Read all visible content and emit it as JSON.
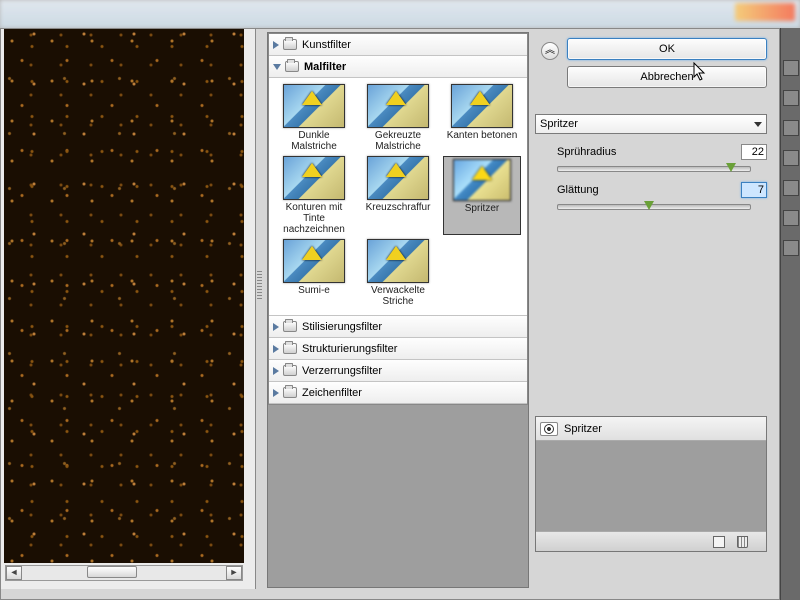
{
  "dialog": {
    "ok_label": "OK",
    "cancel_label": "Abbrechen"
  },
  "categories": {
    "kunstfilter": "Kunstfilter",
    "malfilter": "Malfilter",
    "stilisierung": "Stilisierungsfilter",
    "strukturierung": "Strukturierungsfilter",
    "verzerrung": "Verzerrungsfilter",
    "zeichen": "Zeichenfilter"
  },
  "malfilter_thumbs": [
    "Dunkle Malstriche",
    "Gekreuzte Malstriche",
    "Kanten betonen",
    "Konturen mit Tinte nachzeichnen",
    "Kreuzschraffur",
    "Spritzer",
    "Sumi-e",
    "Verwackelte Striche"
  ],
  "filter_dropdown": "Spritzer",
  "params": {
    "spray_radius_label": "Sprühradius",
    "spray_radius_value": "22",
    "smooth_label": "Glättung",
    "smooth_value": "7"
  },
  "layer_stack": {
    "item": "Spritzer"
  }
}
